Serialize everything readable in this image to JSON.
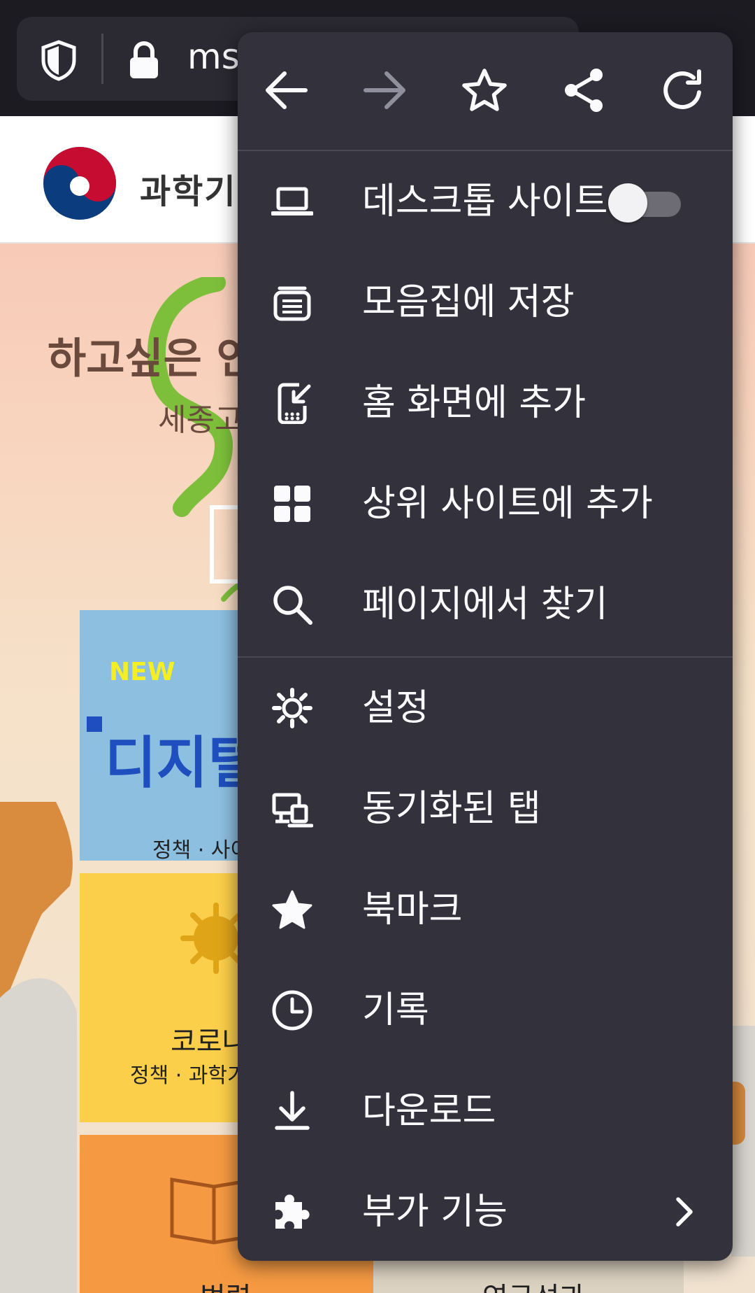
{
  "url_bar": {
    "url_text": "msi"
  },
  "background_page": {
    "org_name": "과학기",
    "hero_title": "하고싶은 연",
    "hero_subtitle": "세종고",
    "tiles": {
      "digital": {
        "badge": "NEW",
        "title": "디지털",
        "caption": "정책 · 사이"
      },
      "corona": {
        "title": "코로나",
        "caption": "정책 · 과학기"
      },
      "law": {
        "title": "법령"
      },
      "research": {
        "title": "연구성과"
      }
    }
  },
  "menu": {
    "nav": {
      "back_icon": "arrow-left-icon",
      "forward_icon": "arrow-right-icon",
      "bookmark_icon": "star-outline-icon",
      "share_icon": "share-icon",
      "reload_icon": "reload-icon"
    },
    "items": [
      {
        "id": "desktop-site",
        "label": "데스크톱 사이트",
        "icon": "laptop-icon",
        "toggle": false
      },
      {
        "id": "save-collection",
        "label": "모음집에 저장",
        "icon": "collection-icon"
      },
      {
        "id": "add-home",
        "label": "홈 화면에 추가",
        "icon": "add-to-homescreen-icon"
      },
      {
        "id": "add-top-sites",
        "label": "상위 사이트에 추가",
        "icon": "grid-icon"
      },
      {
        "id": "find-in-page",
        "label": "페이지에서 찾기",
        "icon": "search-icon"
      },
      {
        "id": "settings",
        "label": "설정",
        "icon": "gear-icon"
      },
      {
        "id": "synced-tabs",
        "label": "동기화된 탭",
        "icon": "synced-tabs-icon"
      },
      {
        "id": "bookmarks",
        "label": "북마크",
        "icon": "star-filled-icon"
      },
      {
        "id": "history",
        "label": "기록",
        "icon": "clock-icon"
      },
      {
        "id": "downloads",
        "label": "다운로드",
        "icon": "download-icon"
      },
      {
        "id": "addons",
        "label": "부가 기능",
        "icon": "puzzle-icon",
        "has_submenu": true
      }
    ]
  },
  "colors": {
    "menu_bg": "#33323c",
    "toolbar_bg": "#1c1b22",
    "url_field_bg": "#2b2a33",
    "text_primary": "#fbfbfe",
    "disabled_icon": "#8f8f9d"
  }
}
